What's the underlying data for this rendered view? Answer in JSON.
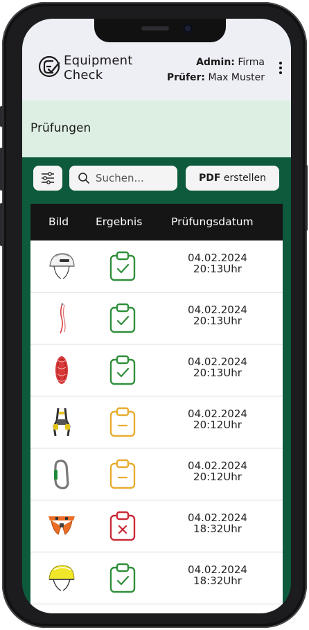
{
  "header": {
    "brand_line1": "Equipment",
    "brand_line2": "Check",
    "admin_label": "Admin:",
    "admin_value": "Firma",
    "pruefer_label": "Prüfer:",
    "pruefer_value": "Max Muster"
  },
  "page": {
    "title": "Prüfungen"
  },
  "toolbar": {
    "search_placeholder": "Suchen...",
    "pdf_bold": "PDF",
    "pdf_rest": " erstellen"
  },
  "table": {
    "columns": [
      "Bild",
      "Ergebnis",
      "Prüfungsdatum"
    ],
    "rows": [
      {
        "item": "helmet-white",
        "result": "pass",
        "date": "04.02.2024",
        "time": "20:13Uhr"
      },
      {
        "item": "cord-red",
        "result": "pass",
        "date": "04.02.2024",
        "time": "20:13Uhr"
      },
      {
        "item": "rope-red",
        "result": "pass",
        "date": "04.02.2024",
        "time": "20:13Uhr"
      },
      {
        "item": "harness-yellow",
        "result": "warning",
        "date": "04.02.2024",
        "time": "20:12Uhr"
      },
      {
        "item": "carabiner-grey",
        "result": "warning",
        "date": "04.02.2024",
        "time": "20:12Uhr"
      },
      {
        "item": "harness-orange",
        "result": "fail",
        "date": "04.02.2024",
        "time": "18:32Uhr"
      },
      {
        "item": "helmet-yellow",
        "result": "pass",
        "date": "04.02.2024",
        "time": "18:32Uhr"
      }
    ]
  },
  "colors": {
    "pass": "#2f8f3a",
    "warning": "#e8ac2e",
    "fail": "#c92a36",
    "app_background": "#0e5a3c",
    "subheader": "#dcefe2",
    "header": "#eeeef5"
  }
}
